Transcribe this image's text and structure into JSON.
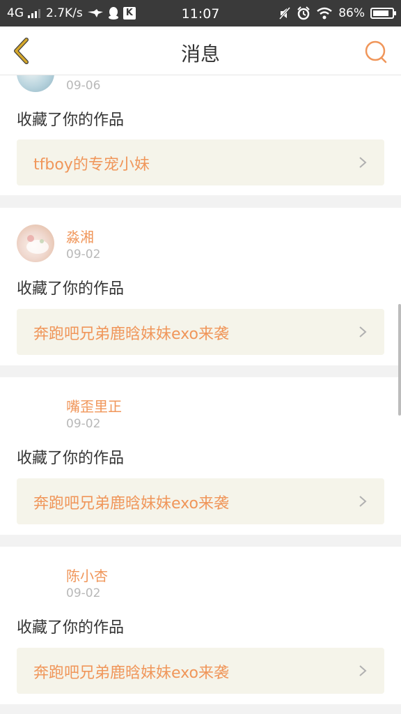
{
  "status_bar": {
    "network": "4G",
    "speed": "2.7K/s",
    "time": "11:07",
    "battery": "86%",
    "battery_level": 0.86,
    "icons": [
      "signal-icon",
      "drone-icon",
      "qq-icon",
      "k-app-icon",
      "mute-icon",
      "alarm-icon",
      "wifi-icon",
      "battery-icon"
    ],
    "k_label": "K"
  },
  "nav": {
    "title": "消息",
    "back_icon": "chevron-left-icon",
    "search_icon": "search-icon"
  },
  "colors": {
    "accent": "#f0965a",
    "back_arrow": "#d4a72c",
    "work_bg": "#f5f4ea"
  },
  "messages": [
    {
      "user": "",
      "date": "09-06",
      "action": "收藏了你的作品",
      "work_title": "tfboy的专宠小妹"
    },
    {
      "user": "淼湘",
      "date": "09-02",
      "action": "收藏了你的作品",
      "work_title": "奔跑吧兄弟鹿晗妹妹exo来袭"
    },
    {
      "user": "嘴歪里正",
      "date": "09-02",
      "action": "收藏了你的作品",
      "work_title": "奔跑吧兄弟鹿晗妹妹exo来袭"
    },
    {
      "user": "陈小杏",
      "date": "09-02",
      "action": "收藏了你的作品",
      "work_title": "奔跑吧兄弟鹿晗妹妹exo来袭"
    }
  ]
}
